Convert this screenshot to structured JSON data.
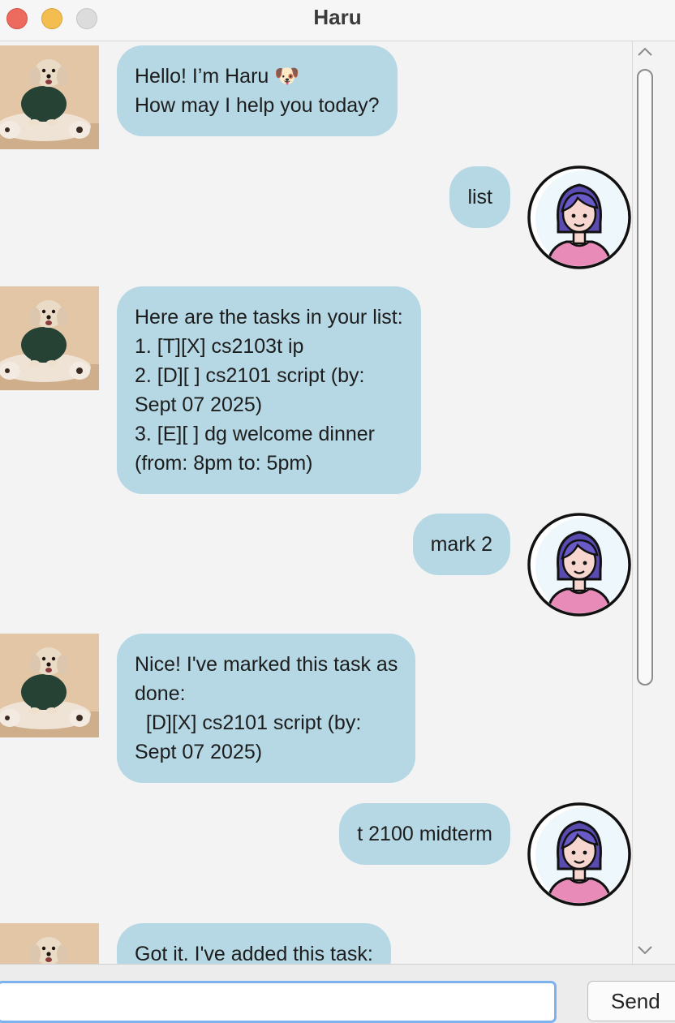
{
  "window": {
    "title": "Haru"
  },
  "messages": [
    {
      "sender": "bot",
      "text": "Hello! I’m Haru 🐶\nHow may I help you today?"
    },
    {
      "sender": "user",
      "text": "list"
    },
    {
      "sender": "bot",
      "text": "Here are the tasks in your list:\n1. [T][X] cs2103t ip\n2. [D][ ] cs2101 script (by:\nSept 07 2025)\n3. [E][ ] dg welcome dinner\n(from: 8pm to: 5pm)"
    },
    {
      "sender": "user",
      "text": "mark 2"
    },
    {
      "sender": "bot",
      "text": "Nice! I've marked this task as\ndone:\n  [D][X] cs2101 script (by:\nSept 07 2025)"
    },
    {
      "sender": "user",
      "text": "t 2100 midterm"
    },
    {
      "sender": "bot",
      "text": "Got it. I've added this task:"
    }
  ],
  "input": {
    "value": "",
    "placeholder": ""
  },
  "send_label": "Send",
  "scrollbar": {
    "up_arrow": "up-arrow-icon",
    "down_arrow": "down-arrow-icon"
  },
  "colors": {
    "bubble": "#b5d8e4",
    "background": "#f3f3f3",
    "input_focus": "#7cb2f0"
  }
}
